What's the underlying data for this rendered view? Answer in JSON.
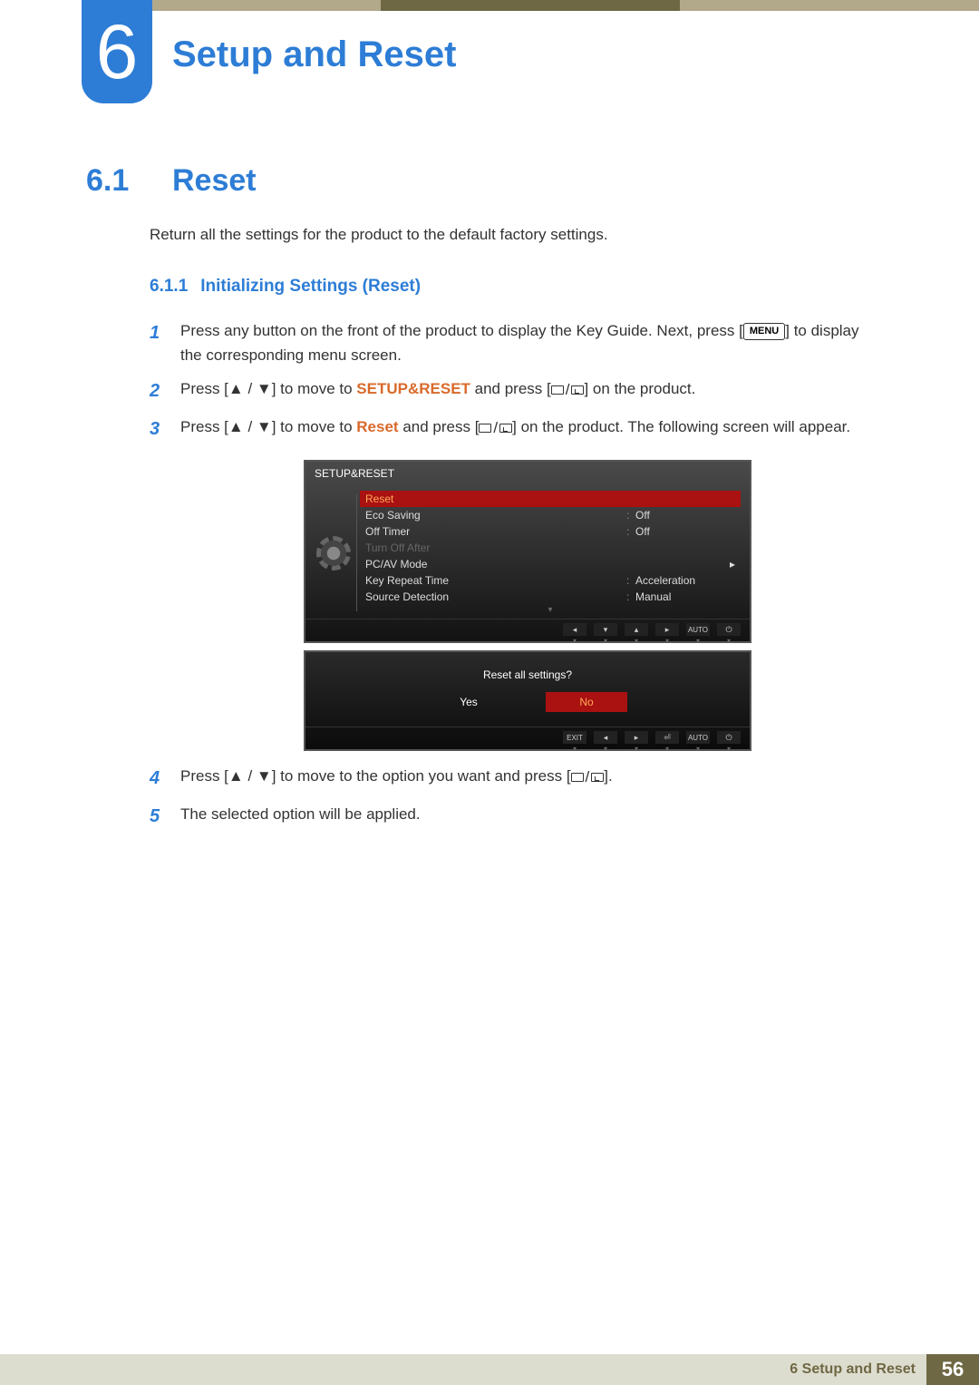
{
  "chapter": {
    "number": "6",
    "title": "Setup and Reset"
  },
  "section": {
    "number": "6.1",
    "title": "Reset",
    "intro": "Return all the settings for the product to the default factory settings."
  },
  "subsection": {
    "number": "6.1.1",
    "title": "Initializing Settings (Reset)"
  },
  "steps": {
    "s1": {
      "num": "1",
      "pre": "Press any button on the front of the product to display the Key Guide. Next, press [",
      "menu": "MENU",
      "post": "] to display the corresponding menu screen."
    },
    "s2": {
      "num": "2",
      "pre": "Press [",
      "updown": "▲ / ▼",
      "mid": "] to move to ",
      "target": "SETUP&RESET",
      "post1": " and press [",
      "post2": "] on the product."
    },
    "s3": {
      "num": "3",
      "pre": "Press [",
      "updown": "▲ / ▼",
      "mid": "] to move to ",
      "target": "Reset",
      "post1": " and press [",
      "post2": "] on the product. The following screen will appear."
    },
    "s4": {
      "num": "4",
      "pre": "Press [",
      "updown": "▲ / ▼",
      "mid": "] to move to the option you want and press [",
      "post": "]."
    },
    "s5": {
      "num": "5",
      "text": "The selected option will be applied."
    }
  },
  "osd": {
    "title": "SETUP&RESET",
    "items": [
      {
        "label": "Reset",
        "value": "",
        "selected": true
      },
      {
        "label": "Eco Saving",
        "colon": ":",
        "value": "Off"
      },
      {
        "label": "Off Timer",
        "colon": ":",
        "value": "Off"
      },
      {
        "label": "Turn Off After",
        "dim": true
      },
      {
        "label": "PC/AV Mode",
        "arrow": "▸"
      },
      {
        "label": "Key Repeat Time",
        "colon": ":",
        "value": "Acceleration"
      },
      {
        "label": "Source Detection",
        "colon": ":",
        "value": "Manual"
      }
    ],
    "nav": [
      "◂",
      "▾",
      "▴",
      "▸",
      "AUTO",
      "⏻"
    ]
  },
  "dialog": {
    "question": "Reset all settings?",
    "yes": "Yes",
    "no": "No",
    "nav": [
      "EXIT",
      "◂",
      "▸",
      "⏎",
      "AUTO",
      "⏻"
    ]
  },
  "footer": {
    "chapter": "6 Setup and Reset",
    "page": "56"
  }
}
